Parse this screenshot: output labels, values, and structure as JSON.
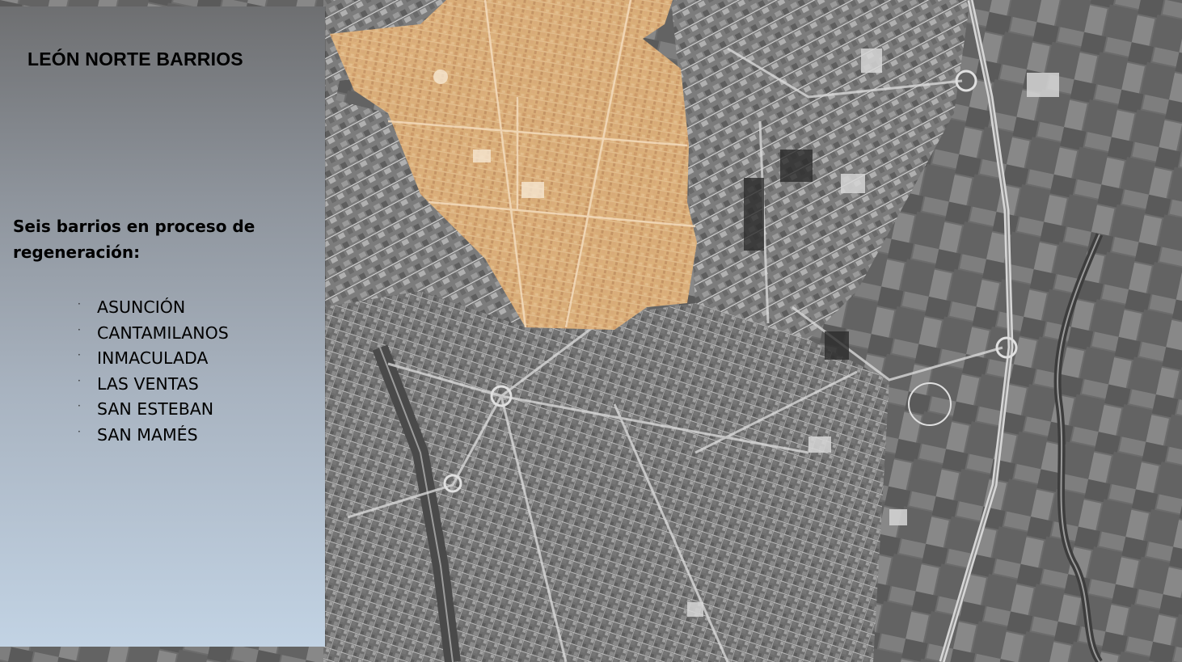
{
  "panel": {
    "title": "LEÓN NORTE BARRIOS",
    "subtitle": "Seis barrios en proceso de regeneración:",
    "bullet_glyph": "·",
    "barrios": [
      "ASUNCIÓN",
      "CANTAMILANOS",
      "INMACULADA",
      "LAS VENTAS",
      "SAN ESTEBAN",
      "SAN MAMÉS"
    ]
  },
  "map": {
    "highlight_color": "#e7b97f",
    "base_tone": "#7a7a7a"
  }
}
